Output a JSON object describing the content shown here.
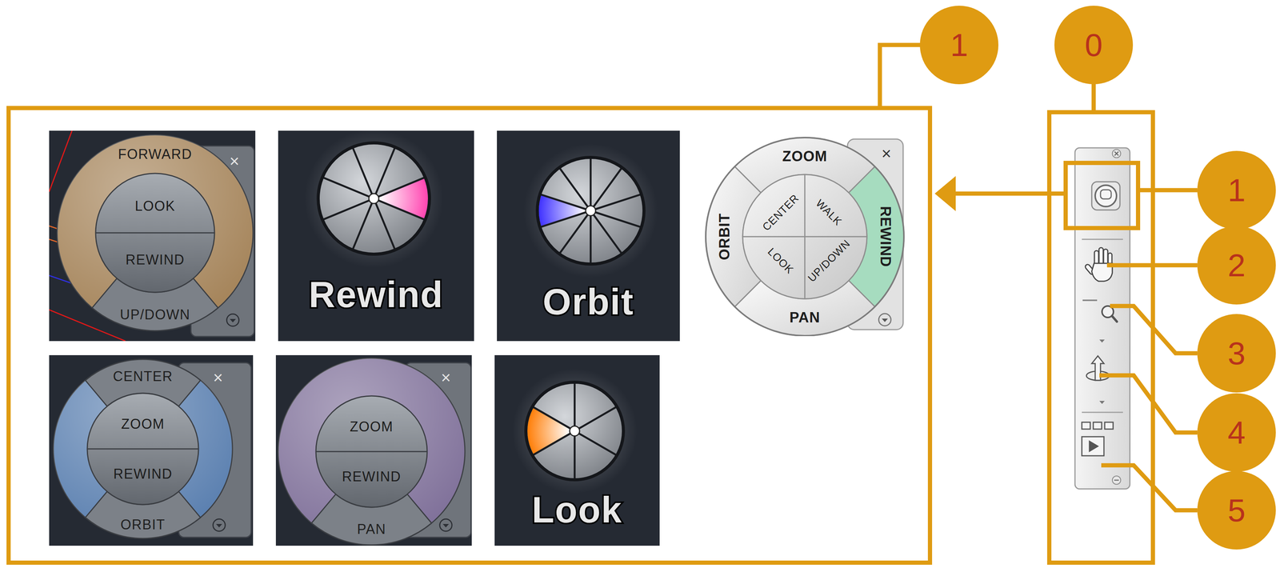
{
  "panel": {
    "callout": "1",
    "rows": [
      [
        {
          "kind": "mini",
          "color": "#a5845a",
          "top": {
            "label": "FORWARD",
            "button": false
          },
          "inner": [
            "LOOK",
            "REWIND"
          ],
          "bottom": "UP/DOWN",
          "close": "×"
        },
        {
          "kind": "tooltip",
          "label": "Rewind",
          "segments": 8,
          "active_segment": 0,
          "color": "#ff3fae"
        },
        {
          "kind": "tooltip",
          "label": "Orbit",
          "segments": 10,
          "active_segment": 5,
          "color": "#3a2cff"
        },
        {
          "kind": "full",
          "outer": [
            {
              "label": "ZOOM",
              "selected": false
            },
            {
              "label": "REWIND",
              "selected": true
            },
            {
              "label": "PAN",
              "selected": false
            },
            {
              "label": "ORBIT",
              "selected": false
            }
          ],
          "inner": [
            "WALK",
            "UP/DOWN",
            "LOOK",
            "CENTER"
          ],
          "close": "×",
          "color": "#a6dcbf"
        }
      ],
      [
        {
          "kind": "mini",
          "color": "#5b80b0",
          "top": {
            "label": "CENTER",
            "button": true
          },
          "inner": [
            "ZOOM",
            "REWIND"
          ],
          "bottom": "ORBIT",
          "close": "×"
        },
        {
          "kind": "mini",
          "color": "#80719a",
          "top": null,
          "inner": [
            "ZOOM",
            "REWIND"
          ],
          "bottom": "PAN",
          "close": "×"
        },
        {
          "kind": "tooltip",
          "label": "Look",
          "segments": 6,
          "active_segment": 3,
          "color": "#ff7a00"
        }
      ]
    ]
  },
  "navigation_bar": {
    "callout": "0",
    "tools": [
      {
        "kind": "wheel",
        "callout": "1",
        "highlighted": true
      },
      {
        "kind": "pan",
        "callout": "2",
        "highlighted": false
      },
      {
        "kind": "zoom",
        "callout": "3",
        "highlighted": false
      },
      {
        "kind": "orbit",
        "callout": "4",
        "highlighted": false
      },
      {
        "kind": "showmotion",
        "callout": "5",
        "highlighted": false
      }
    ]
  }
}
